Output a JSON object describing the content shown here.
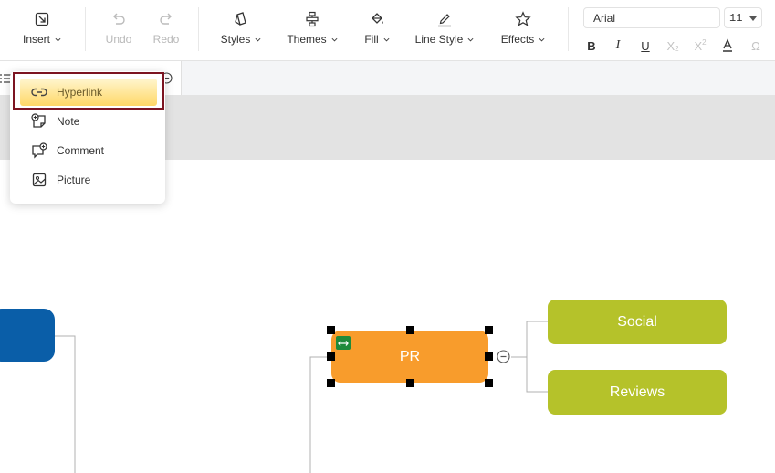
{
  "toolbar": {
    "insert": "Insert",
    "undo": "Undo",
    "redo": "Redo",
    "styles": "Styles",
    "themes": "Themes",
    "fill": "Fill",
    "line_style": "Line Style",
    "effects": "Effects",
    "font_family": "Arial",
    "font_size": "11"
  },
  "menu": {
    "items": [
      {
        "label": "Hyperlink",
        "icon": "link-icon"
      },
      {
        "label": "Note",
        "icon": "note-icon"
      },
      {
        "label": "Comment",
        "icon": "comment-icon"
      },
      {
        "label": "Picture",
        "icon": "picture-icon"
      }
    ]
  },
  "diagram": {
    "pr": "PR",
    "social": "Social",
    "reviews": "Reviews"
  },
  "colors": {
    "pr_fill": "#f89c2c",
    "child_fill": "#b5c22a",
    "left_node_fill": "#0a5ea8",
    "highlight_border": "#7c1421"
  }
}
